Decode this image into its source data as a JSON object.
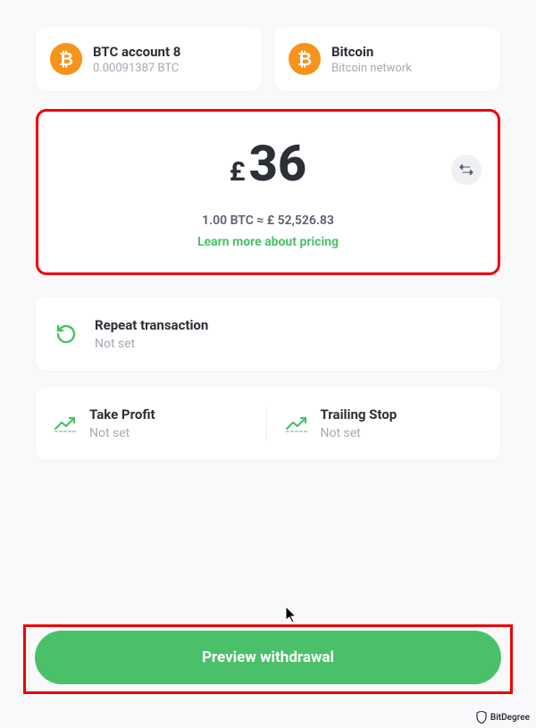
{
  "account": {
    "title": "BTC account 8",
    "balance": "0.00091387 BTC"
  },
  "network": {
    "title": "Bitcoin",
    "sub": "Bitcoin network"
  },
  "amount": {
    "symbol": "£",
    "value": "36",
    "rate": "1.00 BTC ≈ £ 52,526.83",
    "learn_more": "Learn more about pricing"
  },
  "repeat": {
    "title": "Repeat transaction",
    "value": "Not set"
  },
  "take_profit": {
    "title": "Take Profit",
    "value": "Not set"
  },
  "trailing_stop": {
    "title": "Trailing Stop",
    "value": "Not set"
  },
  "preview_button": "Preview withdrawal",
  "watermark": "BitDegree"
}
